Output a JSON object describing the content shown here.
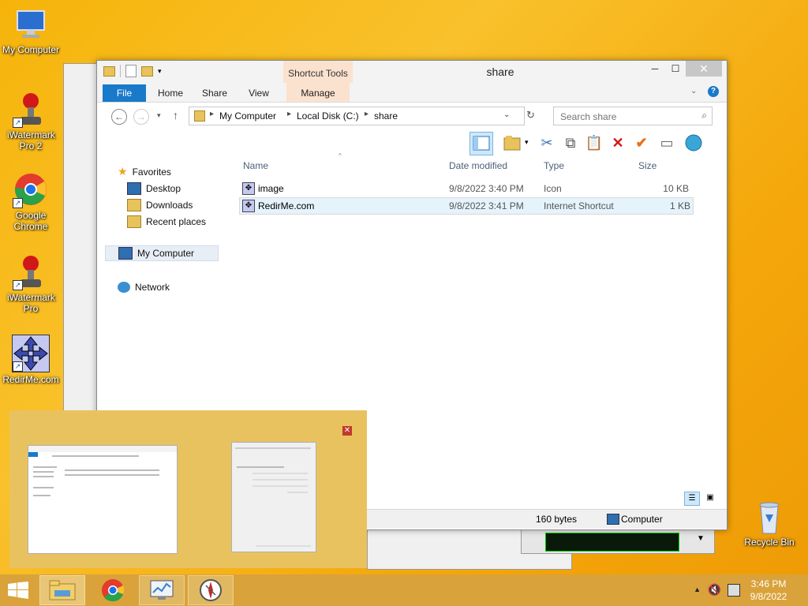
{
  "desktop": {
    "icons": [
      {
        "label": "My Computer"
      },
      {
        "label": "iWatermark Pro 2"
      },
      {
        "label": "Google Chrome"
      },
      {
        "label": "iWatermark Pro"
      },
      {
        "label": "RedirMe.com"
      },
      {
        "label": "Recycle Bin"
      }
    ]
  },
  "window": {
    "title": "share",
    "contextual_tab": "Shortcut Tools",
    "ribbon_tabs": [
      "File",
      "Home",
      "Share",
      "View",
      "Manage"
    ],
    "address": [
      "My Computer",
      "Local Disk (C:)",
      "share"
    ],
    "search_placeholder": "Search share",
    "nav": {
      "favorites": "Favorites",
      "desktop": "Desktop",
      "downloads": "Downloads",
      "recent": "Recent places",
      "computer": "My Computer",
      "network": "Network"
    },
    "columns": [
      "Name",
      "Date modified",
      "Type",
      "Size"
    ],
    "files": [
      {
        "name": "image",
        "date": "9/8/2022 3:40 PM",
        "type": "Icon",
        "size": "10 KB"
      },
      {
        "name": "RedirMe.com",
        "date": "9/8/2022 3:41 PM",
        "type": "Internet Shortcut",
        "size": "1 KB"
      }
    ],
    "status": {
      "size": "160 bytes",
      "location": "Computer"
    }
  },
  "taskbar": {
    "time": "3:46 PM",
    "date": "9/8/2022"
  },
  "colors": {
    "accent": "#1979ca",
    "taskbar": "#d9a23a",
    "popup": "#e9c260"
  }
}
